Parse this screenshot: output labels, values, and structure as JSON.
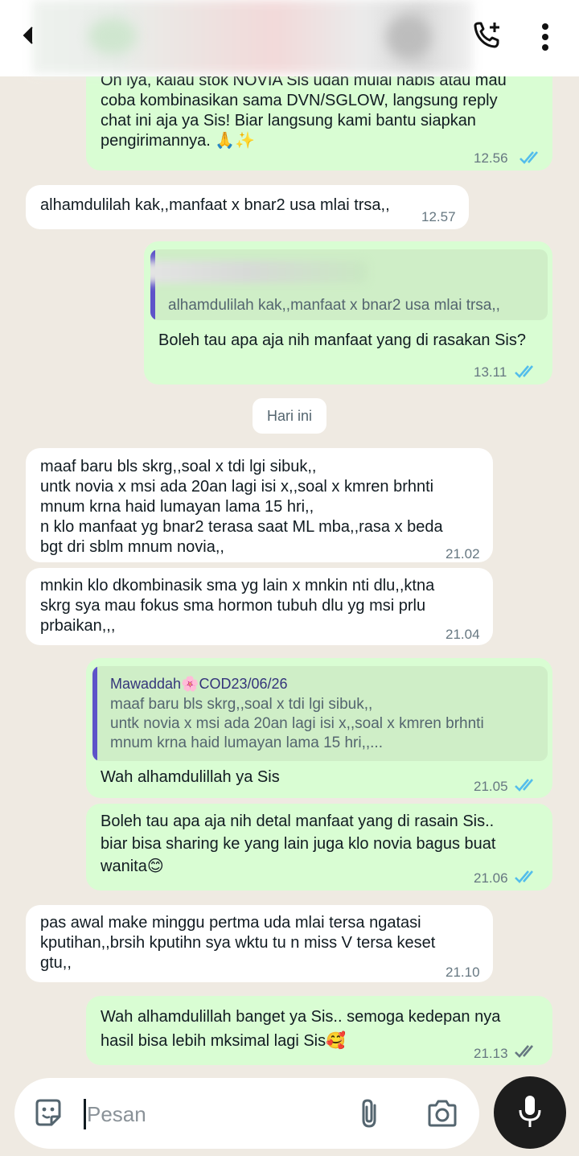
{
  "header": {
    "icons": [
      "back-arrow-icon",
      "add-call-icon",
      "more-vert-icon"
    ]
  },
  "messages": [
    {
      "dir": "out",
      "text": "Oh iya, kalau stok NOVIA Sis udah mulai habis atau mau\ncoba kombinasikan sama DVN/SGLOW, langsung reply\nchat ini aja ya Sis! Biar langsung kami bantu siapkan\npengirimannya. 🙏✨",
      "time": "12.56",
      "status": "read"
    },
    {
      "dir": "in",
      "text": "alhamdulilah kak,,manfaat x bnar2 usa mlai trsa,,",
      "time": "12.57"
    },
    {
      "dir": "out",
      "quote_text": "alhamdulilah kak,,manfaat x bnar2 usa mlai trsa,,",
      "text": "Boleh tau apa aja nih manfaat yang di rasakan Sis?",
      "time": "13.11",
      "status": "read"
    },
    {
      "dir": "in",
      "text": "maaf baru bls skrg,,soal x tdi lgi sibuk,,\nuntk novia x msi ada 20an lagi isi x,,soal x kmren brhnti\nmnum krna haid lumayan lama 15 hri,,\nn klo manfaat yg bnar2 terasa saat ML mba,,rasa x beda\nbgt dri sblm mnum novia,,",
      "time": "21.02"
    },
    {
      "dir": "in",
      "text": "mnkin klo dkombinasik sma yg lain x mnkin nti dlu,,ktna\nskrg sya mau fokus sma hormon tubuh dlu yg msi prlu\nprbaikan,,,",
      "time": "21.04"
    },
    {
      "dir": "out",
      "quote_author": "Mawaddah🌸COD23/06/26",
      "quote_text": "maaf baru bls skrg,,soal x tdi lgi sibuk,,\nuntk novia x msi ada 20an lagi isi x,,soal x kmren brhnti\nmnum krna haid lumayan lama 15 hri,,...",
      "text": "Wah alhamdulillah ya Sis",
      "time": "21.05",
      "status": "read"
    },
    {
      "dir": "out",
      "text": "Boleh tau apa aja nih detal manfaat yang di rasain Sis..\nbiar bisa sharing ke yang lain juga klo novia bagus buat\nwanita😊",
      "time": "21.06",
      "status": "read"
    },
    {
      "dir": "in",
      "text": "pas awal make minggu pertma uda mlai tersa ngatasi\nkputihan,,brsih kputihn sya wktu tu n miss V tersa keset\ngtu,,",
      "time": "21.10"
    },
    {
      "dir": "out",
      "text": "Wah alhamdulillah banget ya Sis.. semoga kedepan nya\nhasil bisa lebih mksimal lagi Sis🥰",
      "time": "21.13",
      "status": "delivered"
    }
  ],
  "date_separator": "Hari ini",
  "composer": {
    "placeholder": "Pesan",
    "icons": [
      "sticker-icon",
      "attach-icon",
      "camera-icon",
      "mic-icon"
    ]
  },
  "colors": {
    "background": "#efeae2",
    "incoming": "#ffffff",
    "outgoing": "#d9fdd3",
    "read_ticks": "#53bdeb",
    "quote_bar": "#5e53c9"
  }
}
